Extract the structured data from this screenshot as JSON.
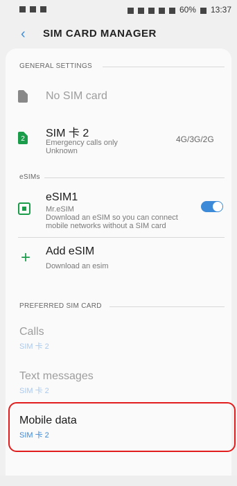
{
  "status_bar": {
    "time": "13:37",
    "battery": "60%"
  },
  "header": {
    "title": "SIM CARD MANAGER",
    "back_icon": "chevron-left-icon"
  },
  "general_settings": {
    "label": "GENERAL SETTINGS",
    "no_sim": {
      "title": "No SIM card"
    },
    "sim2": {
      "badge": "2",
      "title": "SIM 卡 2",
      "line1": "Emergency calls only",
      "line2": "Unknown",
      "network": "4G/3G/2G"
    }
  },
  "esims": {
    "label": "eSIMs",
    "esim1": {
      "title": "eSIM1",
      "subtitle": "Mr.eSIM",
      "desc1": "Download an eSIM so you can connect",
      "desc2": "mobile networks without a SIM card",
      "enabled": true
    },
    "add": {
      "title": "Add eSIM",
      "subtitle": "Download an esim"
    }
  },
  "preferred": {
    "label": "PREFERRED SIM CARD",
    "calls": {
      "title": "Calls",
      "value": "SIM 卡 2"
    },
    "texts": {
      "title": "Text messages",
      "value": "SIM 卡 2"
    },
    "mobile_data": {
      "title": "Mobile data",
      "value": "SIM 卡 2"
    }
  }
}
